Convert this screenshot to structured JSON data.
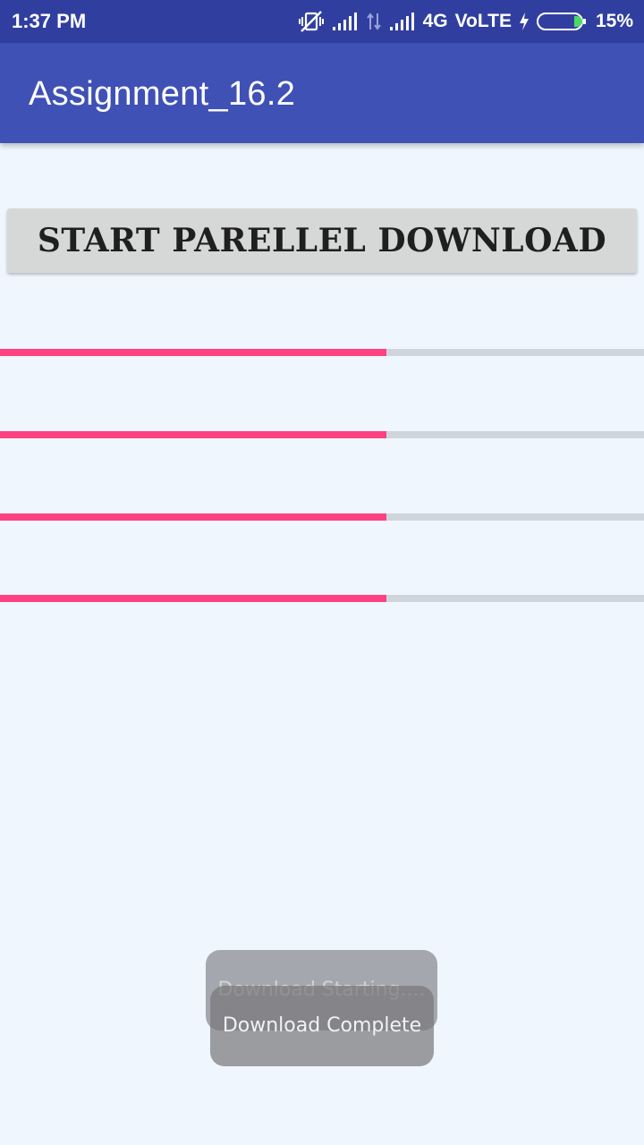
{
  "status_bar": {
    "time": "1:37 PM",
    "network": "4G",
    "volte": "VoLTE",
    "battery_percent": "15%",
    "icons": [
      "vibrate-off-icon",
      "signal-icon",
      "data-transfer-icon",
      "signal-icon",
      "charging-icon",
      "battery-icon"
    ]
  },
  "app_bar": {
    "title": "Assignment_16.2"
  },
  "main": {
    "start_button_label": "START PARELLEL DOWNLOAD",
    "progress_bars": [
      {
        "progress": 0.6
      },
      {
        "progress": 0.6
      },
      {
        "progress": 0.6
      },
      {
        "progress": 0.6
      }
    ],
    "progress_color": "#ff4081",
    "track_color": "#cfd5dd"
  },
  "toasts": [
    {
      "text": "Download Starting...."
    },
    {
      "text": "Download Complete"
    }
  ],
  "colors": {
    "status_bar": "#303f9f",
    "app_bar": "#3f51b5",
    "background": "#eff6fe",
    "accent": "#ff4081"
  }
}
